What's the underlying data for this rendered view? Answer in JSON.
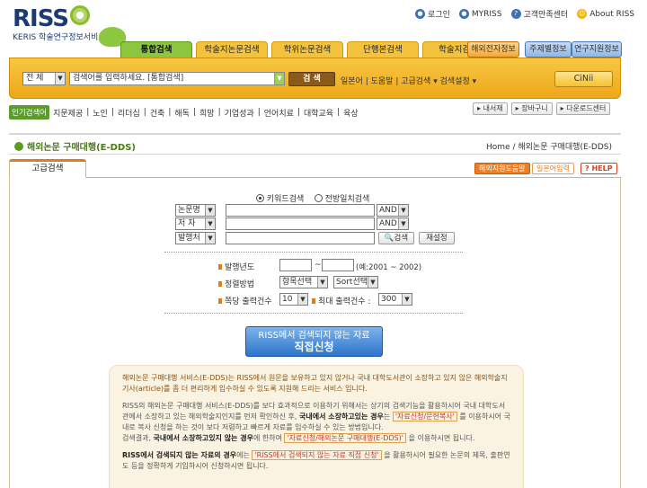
{
  "logo": {
    "big": "RISS",
    "small": "KERIS 학술연구정보서비스"
  },
  "toplinks": [
    {
      "icon": "login-icon",
      "label": "로그인"
    },
    {
      "icon": "user-icon",
      "label": "MYRISS"
    },
    {
      "icon": "help-icon",
      "label": "고객만족센터"
    },
    {
      "icon": "smile-icon",
      "label": "About  RISS"
    }
  ],
  "main_tabs": [
    "통합검색",
    "학술지논문검색",
    "학위논문검색",
    "단행본검색",
    "학술지검색"
  ],
  "right_tabs": [
    "해외전자정보",
    "주제별정보",
    "연구지원정보"
  ],
  "search": {
    "scope": "전  체",
    "query": "검색어를 입력하세요. [통합검색]",
    "button": "검 색",
    "links": [
      "일본어",
      "도움말",
      "고급검색",
      "검색설정"
    ],
    "cinii": "CiNii"
  },
  "keywords": {
    "label": "인기검색어",
    "items": [
      "지문제공",
      "노인",
      "리더십",
      "건축",
      "해독",
      "희망",
      "기업성과",
      "언어치료",
      "대학교육",
      "육상"
    ]
  },
  "kw_buttons": [
    "내서재",
    "장바구니",
    "다운로드센터"
  ],
  "breadcrumb": {
    "title": "해외논문 구매대행(E-DDS)",
    "path": "Home / 해외논문 구매대행(E-DDS)"
  },
  "page_tab": "고급검색",
  "page_buttons": [
    "해외지원도움말",
    "일본어입력",
    "HELP"
  ],
  "form": {
    "radio1": "키워드검색",
    "radio2": "전방일치검색",
    "fields": [
      "논문명",
      "저  자",
      "발행처"
    ],
    "ops": [
      "AND",
      "AND"
    ],
    "search_btn": "검색",
    "reset_btn": "재설정",
    "year_label": "발행년도",
    "year_sep": "~",
    "year_hint": "(예:2001 ~ 2002)",
    "sort_label": "정렬방법",
    "sort1": "항목선택",
    "sort2": "Sort선택",
    "per_label": "쪽당 출력건수",
    "per_val": "10",
    "max_label": "최대 출력건수 :",
    "max_val": "300"
  },
  "big_button": {
    "line1": "RISS에서 검색되지 않는 자료",
    "line2": "직접신청"
  },
  "info": {
    "p1": "해외논문 구매대행 서비스(E-DDS)는 RISS에서 원문을 보유하고 있지 않거나 국내 대학도서관이 소장하고 있지 않은 해외학술지 기사(article)를 좀 더 편리하게 입수하실 수 있도록 지원해 드리는 서비스 입니다.",
    "p2a": "RISS의 해외논문 구매대행 서비스(E-DDS)를 보다 효과적으로 이용하기 위해서는 상기의 검색기능을 활용하시어 국내 대학도서관에서 소장하고 있는 해외학술지인지를 먼저 확인하신 후,",
    "p2b": "국내에서 소장하고있는 경우",
    "p2c": "는",
    "p2d": "'자료신청/문헌복사'",
    "p2e": "를 이용하시어 국내로 복사 신청을 하는 것이 보다 저렴하고 빠르게 자료를 입수하실 수 있는 방법입니다.",
    "p3a": "검색결과,",
    "p3b": "국내에서 소장하고있지 않는 경우",
    "p3c": "에 한하여",
    "p3d": "'자료신청/해외논문 구매대행(E-DDS)'",
    "p3e": "을 이용하시면 됩니다.",
    "p4a": "RISS에서 검색되지 않는 자료의 경우",
    "p4b": "에는",
    "p4c": "'RISS에서 검색되지 않는 자료 직접 신청'",
    "p4d": "을 활용하시어 필요한 논문의 제목, 출판연도 등을 정확하게 기입하시어 신청하시면 됩니다."
  }
}
